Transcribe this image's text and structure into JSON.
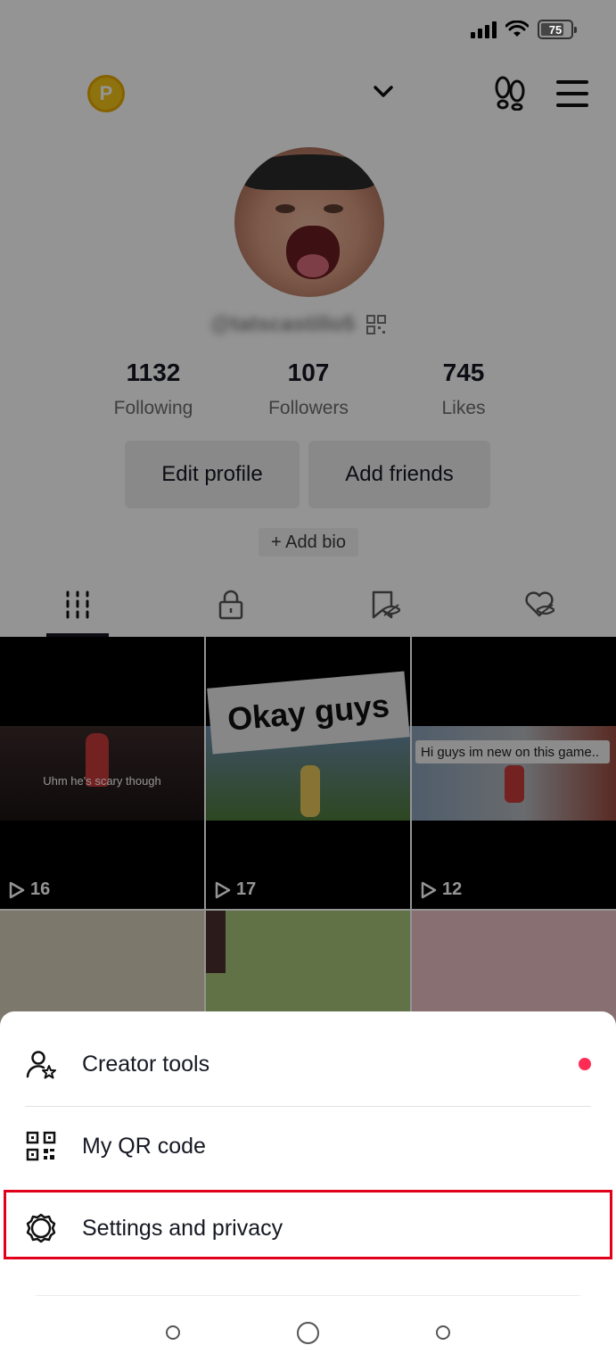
{
  "status_bar": {
    "battery": "75"
  },
  "profile": {
    "coin_letter": "P",
    "handle": "@tatscastillo5",
    "stats": [
      {
        "value": "1132",
        "label": "Following"
      },
      {
        "value": "107",
        "label": "Followers"
      },
      {
        "value": "745",
        "label": "Likes"
      }
    ],
    "edit_profile": "Edit profile",
    "add_friends": "Add friends",
    "add_bio": "+ Add bio"
  },
  "tabs": [
    "videos-grid-icon",
    "private-lock-icon",
    "favorites-hidden-icon",
    "liked-hidden-icon"
  ],
  "videos": [
    {
      "views": "16",
      "caption": "Uhm he's scary though"
    },
    {
      "views": "17",
      "caption": "Okay guys"
    },
    {
      "views": "12",
      "caption": "Hi guys im new on this game.."
    }
  ],
  "menu": {
    "items": [
      {
        "label": "Creator tools",
        "icon": "creator-tools-icon"
      },
      {
        "label": "My QR code",
        "icon": "qr-code-icon"
      },
      {
        "label": "Settings and privacy",
        "icon": "settings-gear-icon"
      }
    ]
  },
  "colors": {
    "accent": "#fe2c55",
    "highlight": "#e0001b"
  }
}
